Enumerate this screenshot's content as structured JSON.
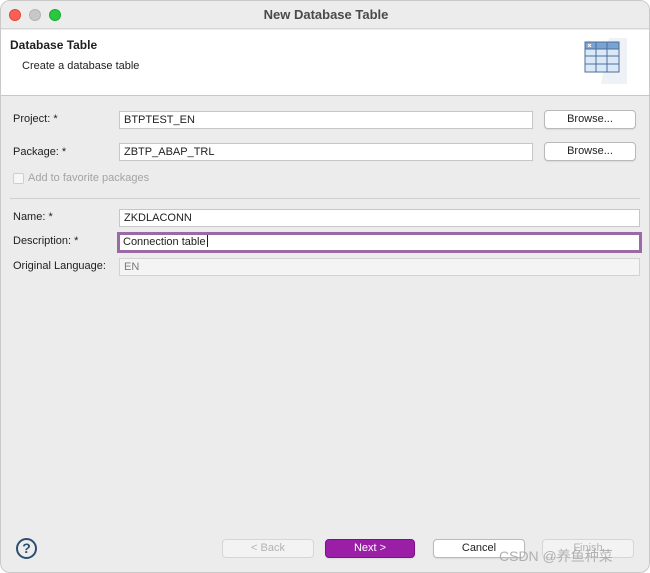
{
  "window": {
    "title": "New Database Table"
  },
  "banner": {
    "title": "Database Table",
    "subtitle": "Create a database table",
    "icon": "table-icon"
  },
  "form": {
    "project_label": "Project: *",
    "project_value": "BTPTEST_EN",
    "package_label": "Package: *",
    "package_value": "ZBTP_ABAP_TRL",
    "browse_label": "Browse...",
    "favorite_label": "Add to favorite packages",
    "name_label": "Name: *",
    "name_value": "ZKDLACONN",
    "description_label": "Description: *",
    "description_value": "Connection table",
    "language_label": "Original Language:",
    "language_value": "EN"
  },
  "footer": {
    "help_symbol": "?",
    "back_label": "< Back",
    "next_label": "Next >",
    "cancel_label": "Cancel",
    "finish_label": "Finish"
  },
  "watermark": "CSDN @养鱼种菜",
  "colors": {
    "primary": "#9a1fa6",
    "focus_ring": "#9b6aa6"
  }
}
